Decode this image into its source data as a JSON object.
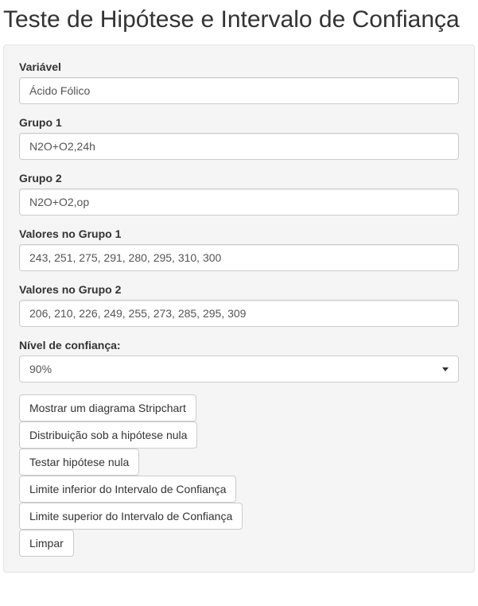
{
  "title": "Teste de Hipótese e Intervalo de Confiança",
  "form": {
    "variavel": {
      "label": "Variável",
      "value": "Ácido Fólico"
    },
    "grupo1": {
      "label": "Grupo 1",
      "value": "N2O+O2,24h"
    },
    "grupo2": {
      "label": "Grupo 2",
      "value": "N2O+O2,op"
    },
    "valores1": {
      "label": "Valores no Grupo 1",
      "value": "243, 251, 275, 291, 280, 295, 310, 300"
    },
    "valores2": {
      "label": "Valores no Grupo 2",
      "value": "206, 210, 226, 249, 255, 273, 285, 295, 309"
    },
    "confianca": {
      "label": "Nível de confiança:",
      "selected": "90%"
    }
  },
  "buttons": {
    "stripchart": "Mostrar um diagrama Stripchart",
    "dist_nula": "Distribuição sob a hipótese nula",
    "testar": "Testar hipótese nula",
    "lim_inf": "Limite inferior do Intervalo de Confiança",
    "lim_sup": "Limite superior do Intervalo de Confiança",
    "limpar": "Limpar"
  }
}
